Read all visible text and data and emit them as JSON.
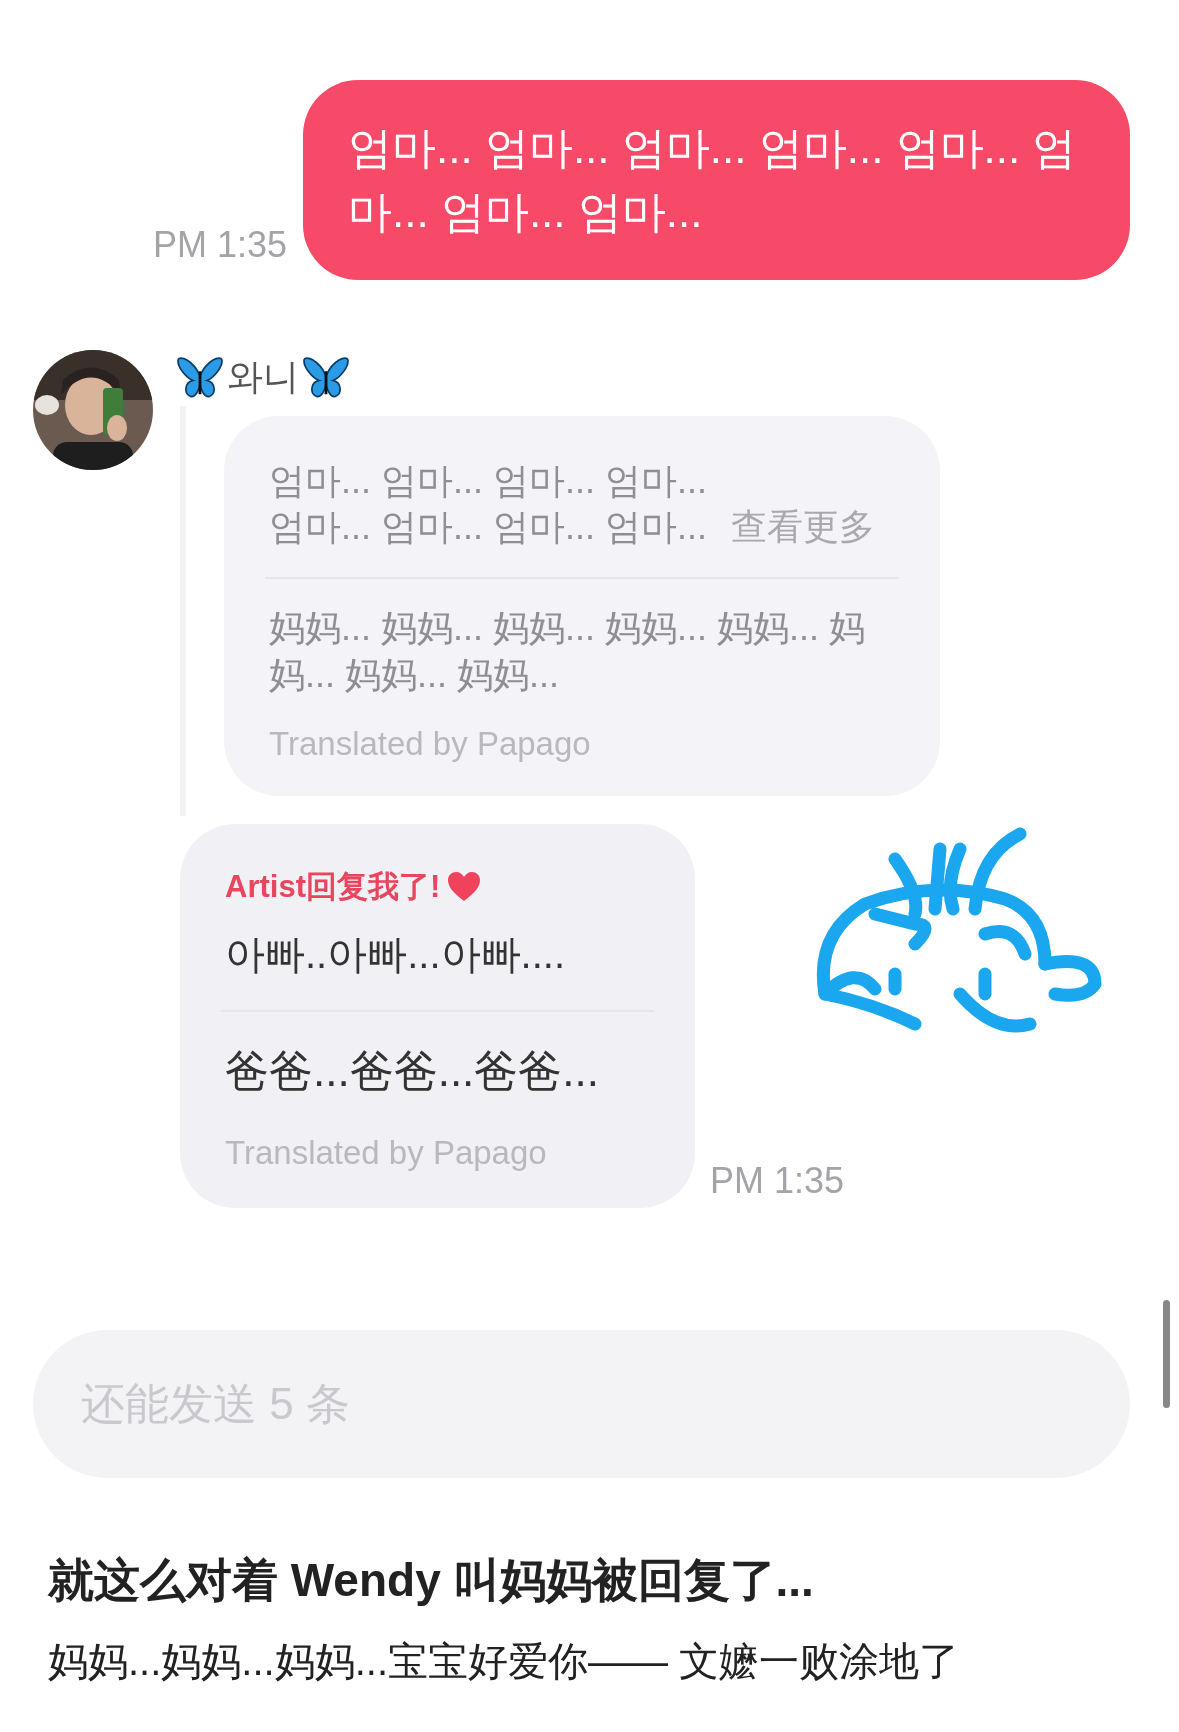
{
  "outgoing": {
    "text": "엄마... 엄마... 엄마... 엄마... 엄마... 엄마... 엄마... 엄마...",
    "time": "PM 1:35"
  },
  "sender": {
    "name": "와니"
  },
  "replies": [
    {
      "kind": "thread",
      "original_lines": [
        "엄마... 엄마... 엄마... 엄마...",
        "엄마... 엄마... 엄마... 엄마..."
      ],
      "more": "查看更多",
      "translation": "妈妈... 妈妈... 妈妈... 妈妈... 妈妈... 妈妈... 妈妈... 妈妈...",
      "credit": "Translated by Papago"
    },
    {
      "kind": "artist",
      "badge": "Artist回复我了!",
      "original": "아빠..아빠...아빠....",
      "translation": "爸爸...爸爸...爸爸...",
      "credit": "Translated by Papago",
      "time": "PM 1:35"
    }
  ],
  "input": {
    "placeholder": "还能发送 5 条"
  },
  "caption": {
    "title": "就这么对着 Wendy 叫妈妈被回复了...",
    "body": "妈妈...妈妈...妈妈...宝宝好爱你—— 文嬷一败涂地了"
  }
}
